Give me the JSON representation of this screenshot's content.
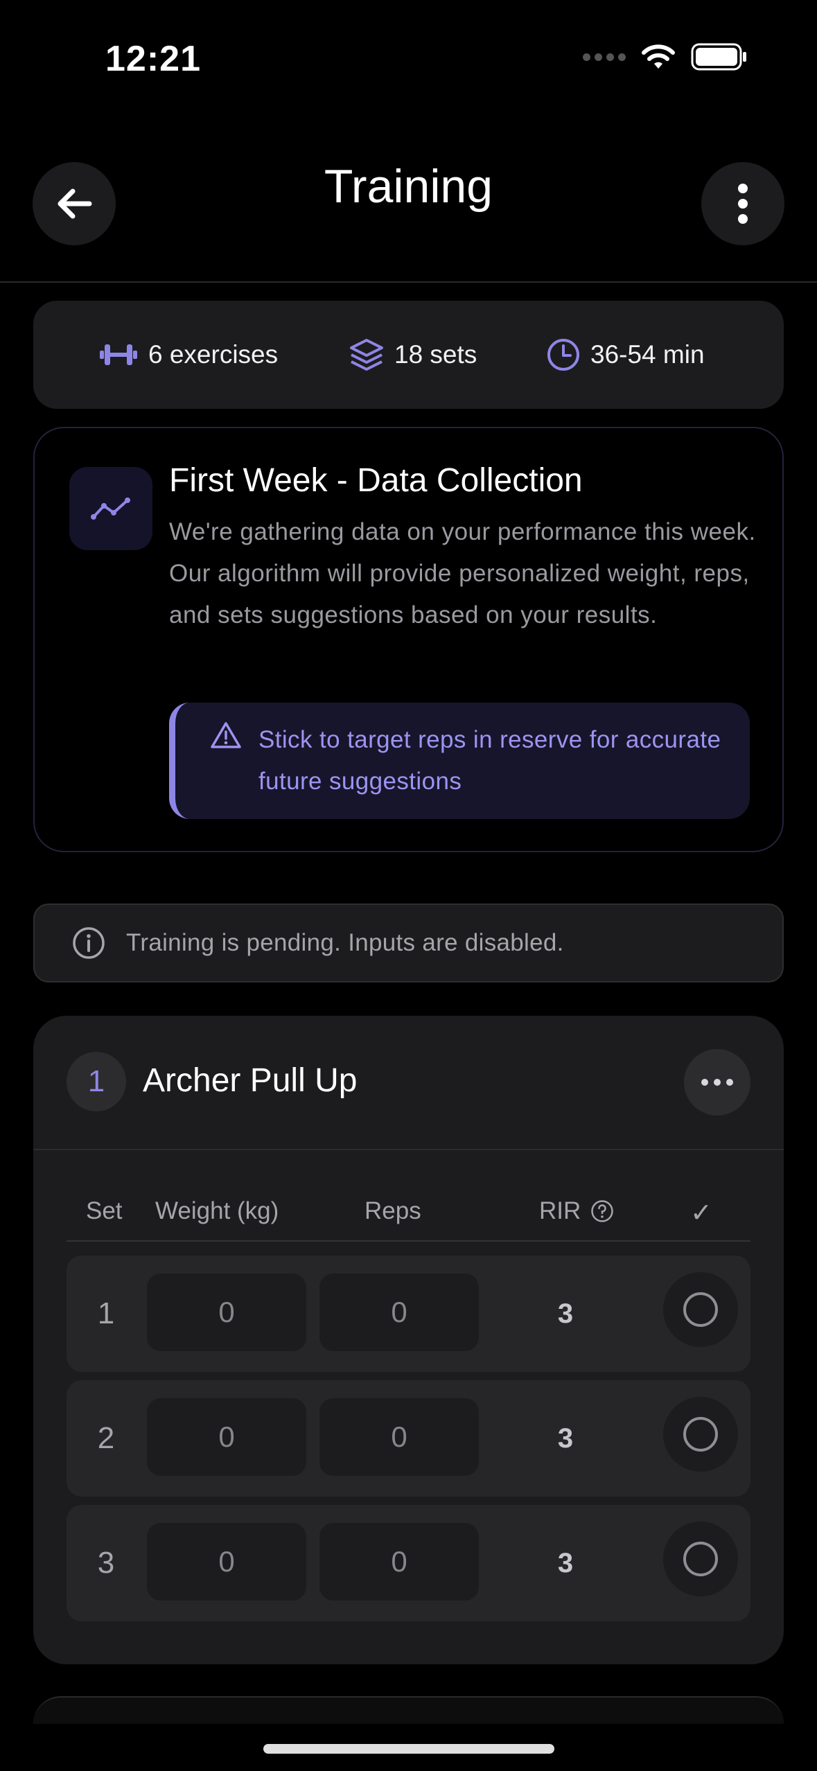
{
  "status_bar": {
    "time": "12:21"
  },
  "nav": {
    "title": "Training"
  },
  "summary": {
    "exercises": "6 exercises",
    "sets": "18 sets",
    "duration": "36-54 min"
  },
  "info_card": {
    "title": "First Week - Data Collection",
    "body": "We're gathering data on your performance this week. Our algorithm will provide personalized weight, reps, and sets suggestions based on your results.",
    "tip": "Stick to target reps in reserve for accurate future suggestions"
  },
  "pending_banner": {
    "text": "Training is pending. Inputs are disabled."
  },
  "exercise": {
    "number": "1",
    "name": "Archer Pull Up",
    "columns": {
      "set": "Set",
      "weight": "Weight (kg)",
      "reps": "Reps",
      "rir": "RIR",
      "done": "✓"
    },
    "rows": [
      {
        "set": "1",
        "weight": "0",
        "reps": "0",
        "rir": "3"
      },
      {
        "set": "2",
        "weight": "0",
        "reps": "0",
        "rir": "3"
      },
      {
        "set": "3",
        "weight": "0",
        "reps": "0",
        "rir": "3"
      }
    ]
  },
  "colors": {
    "accent": "#8e86e6",
    "background": "#000000",
    "card": "#1c1c1e"
  }
}
